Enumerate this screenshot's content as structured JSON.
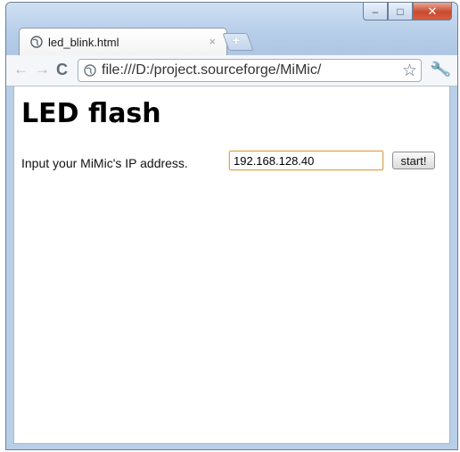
{
  "window": {
    "controls": {
      "minimize": "–",
      "maximize": "□",
      "close": "✕"
    }
  },
  "tab": {
    "title": "led_blink.html",
    "close_glyph": "×",
    "icon": "globe-icon"
  },
  "newtab": {
    "glyph": "+"
  },
  "toolbar": {
    "back_glyph": "←",
    "forward_glyph": "→",
    "reload_glyph": "C",
    "url": "file:///D:/project.sourceforge/MiMic/",
    "star_glyph": "☆",
    "wrench_glyph": "🔧"
  },
  "page": {
    "heading": "LED flash",
    "prompt": "Input your MiMic's IP address.",
    "ip_value": "192.168.128.40",
    "start_label": "start!"
  },
  "colors": {
    "frame": "#b9cfe8",
    "close_button": "#c94a2e",
    "input_focus": "#d8a253"
  }
}
